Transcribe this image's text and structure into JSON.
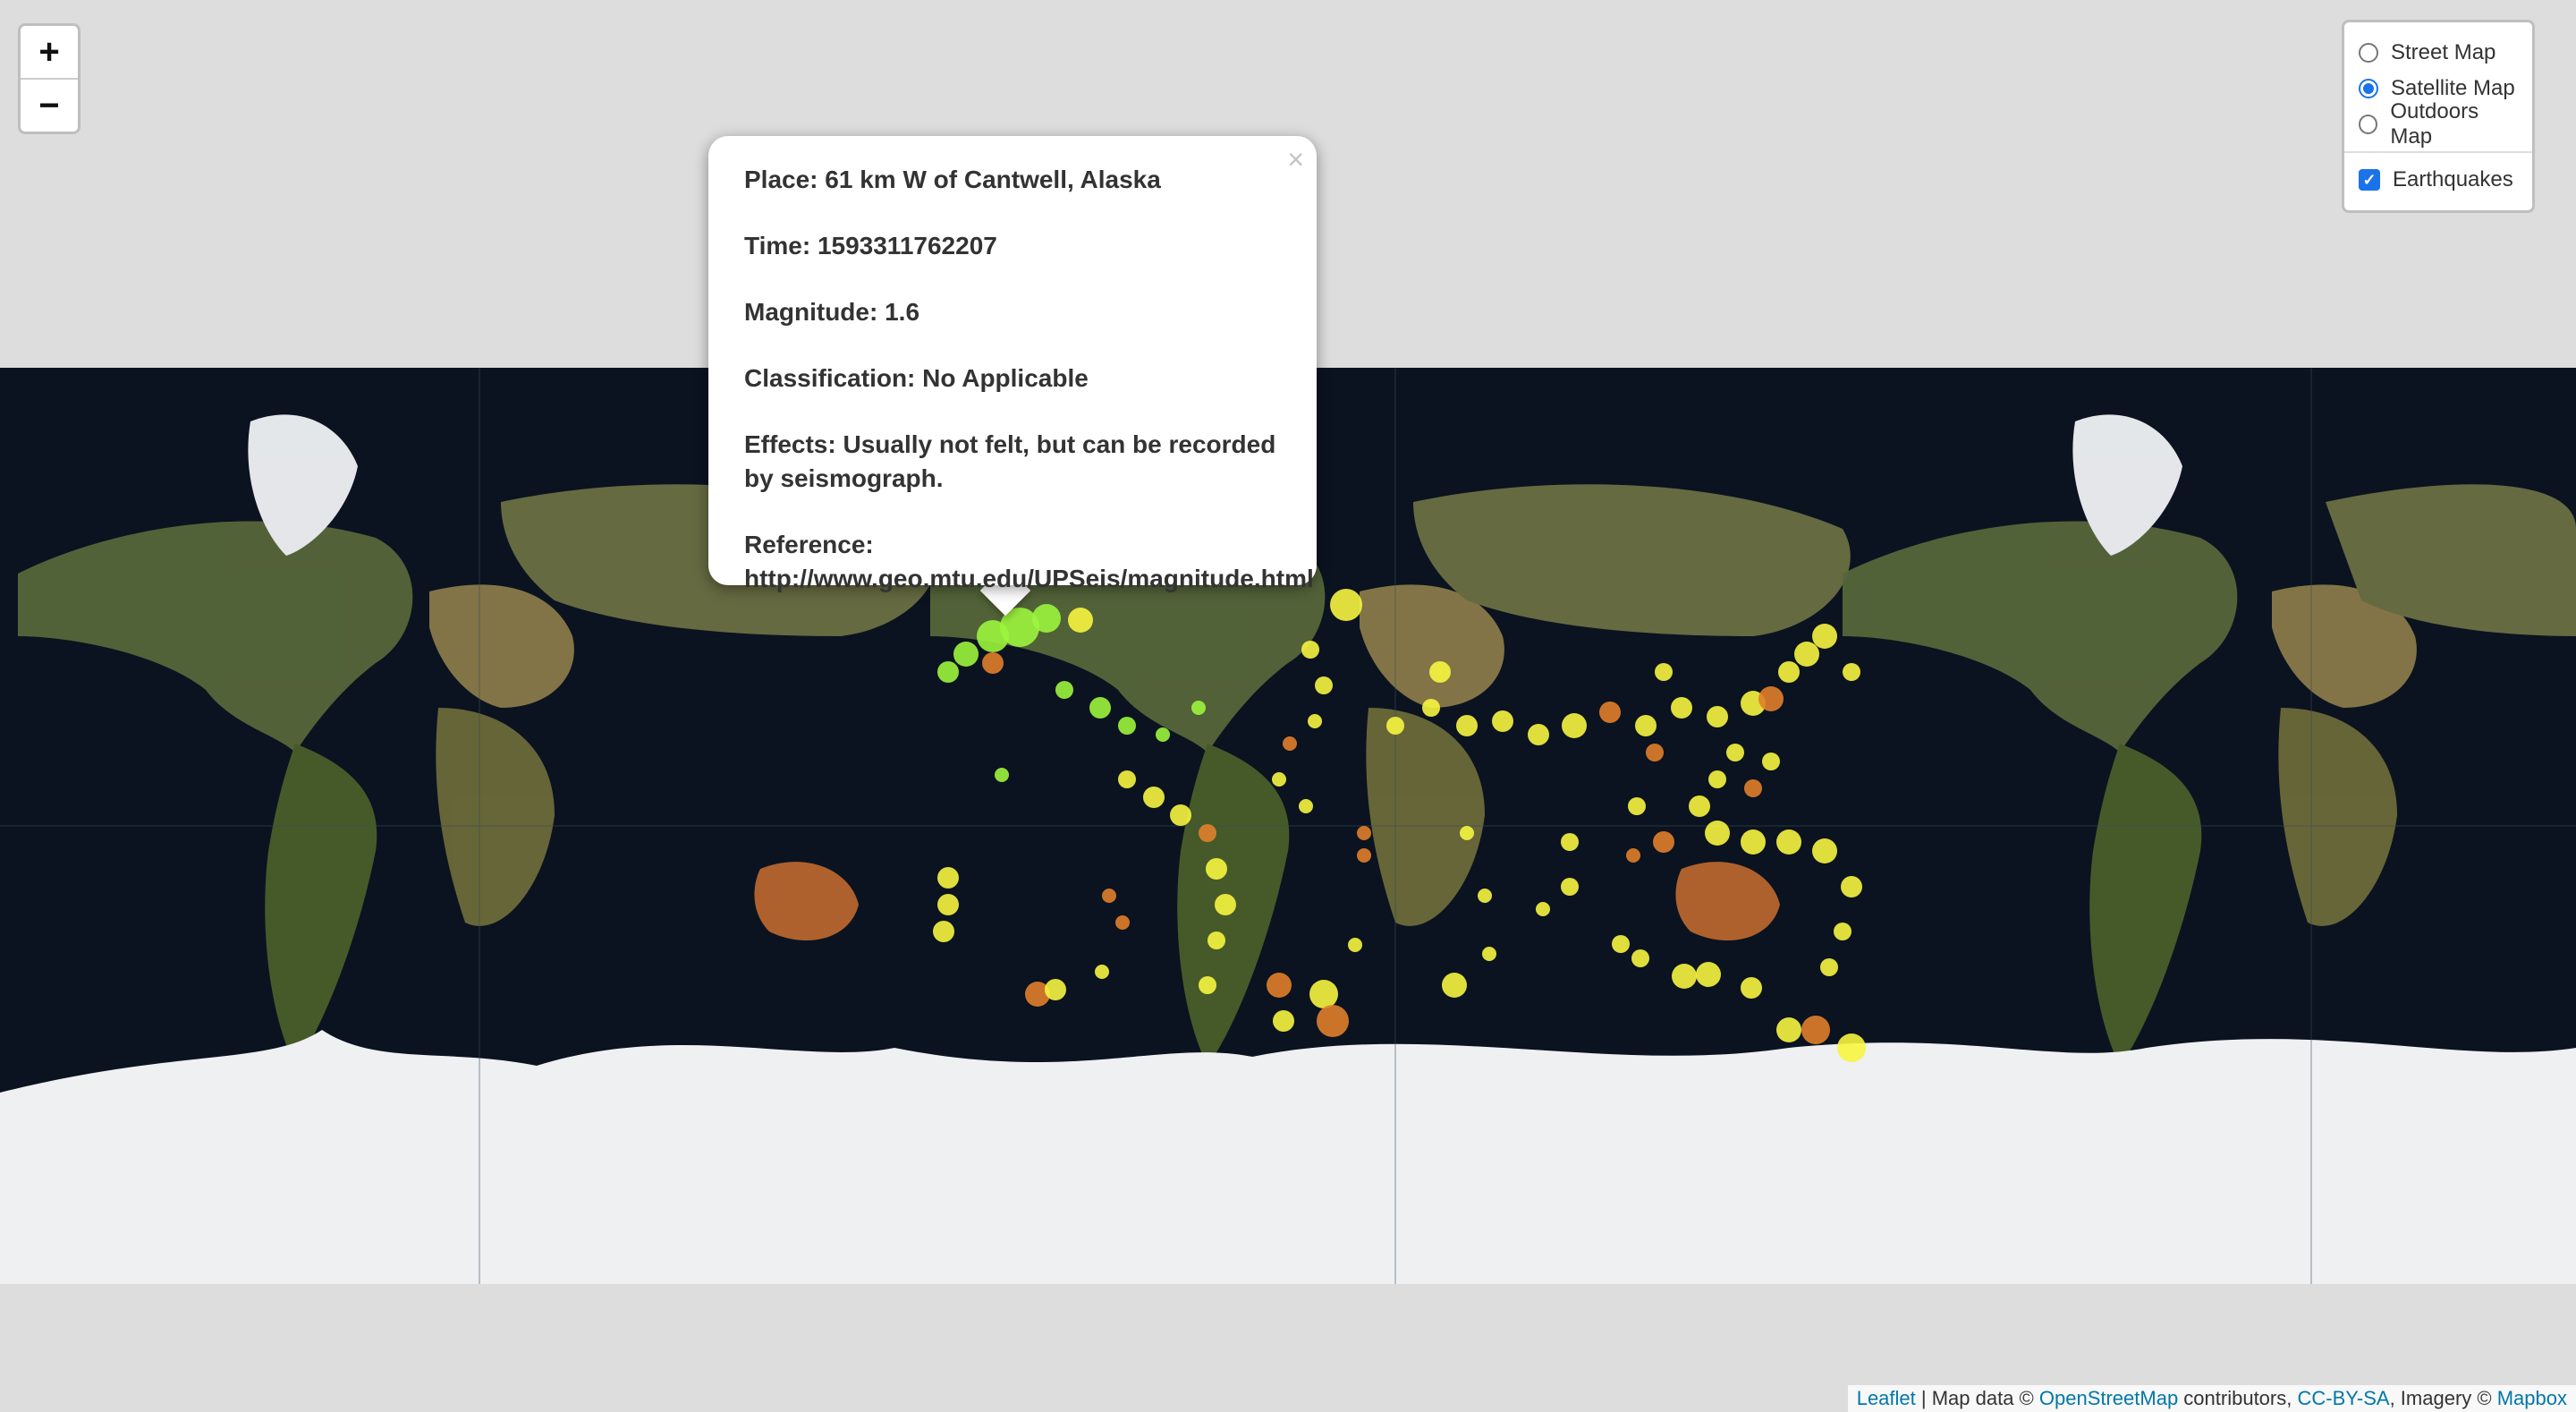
{
  "zoom": {
    "in_label": "+",
    "out_label": "−"
  },
  "layer_control": {
    "base_layers": [
      {
        "label": "Street Map",
        "selected": false
      },
      {
        "label": "Satellite Map",
        "selected": true
      },
      {
        "label": "Outdoors Map",
        "selected": false
      }
    ],
    "overlays": [
      {
        "label": "Earthquakes",
        "checked": true
      }
    ]
  },
  "popup": {
    "close": "×",
    "lines": [
      "Place: 61 km W of Cantwell, Alaska",
      "Time: 1593311762207",
      "Magnitude: 1.6",
      "Classification: No Applicable",
      "Effects: Usually not felt, but can be recorded by seismograph.",
      "Reference: http://www.geo.mtu.edu/UPSeis/magnitude.html"
    ]
  },
  "attribution": {
    "leaflet": "Leaflet",
    "sep": " | Map data © ",
    "osm": "OpenStreetMap",
    "contrib": " contributors, ",
    "license": "CC-BY-SA",
    "imagery": ", Imagery © ",
    "mapbox": "Mapbox"
  },
  "colors": {
    "ocean": "#0b1320",
    "land": "#5d6b3a",
    "ice": "#eef0f2",
    "marker_low": "#9cf53d",
    "marker_mid": "#f6f53f",
    "marker_high": "#e0802a"
  }
}
